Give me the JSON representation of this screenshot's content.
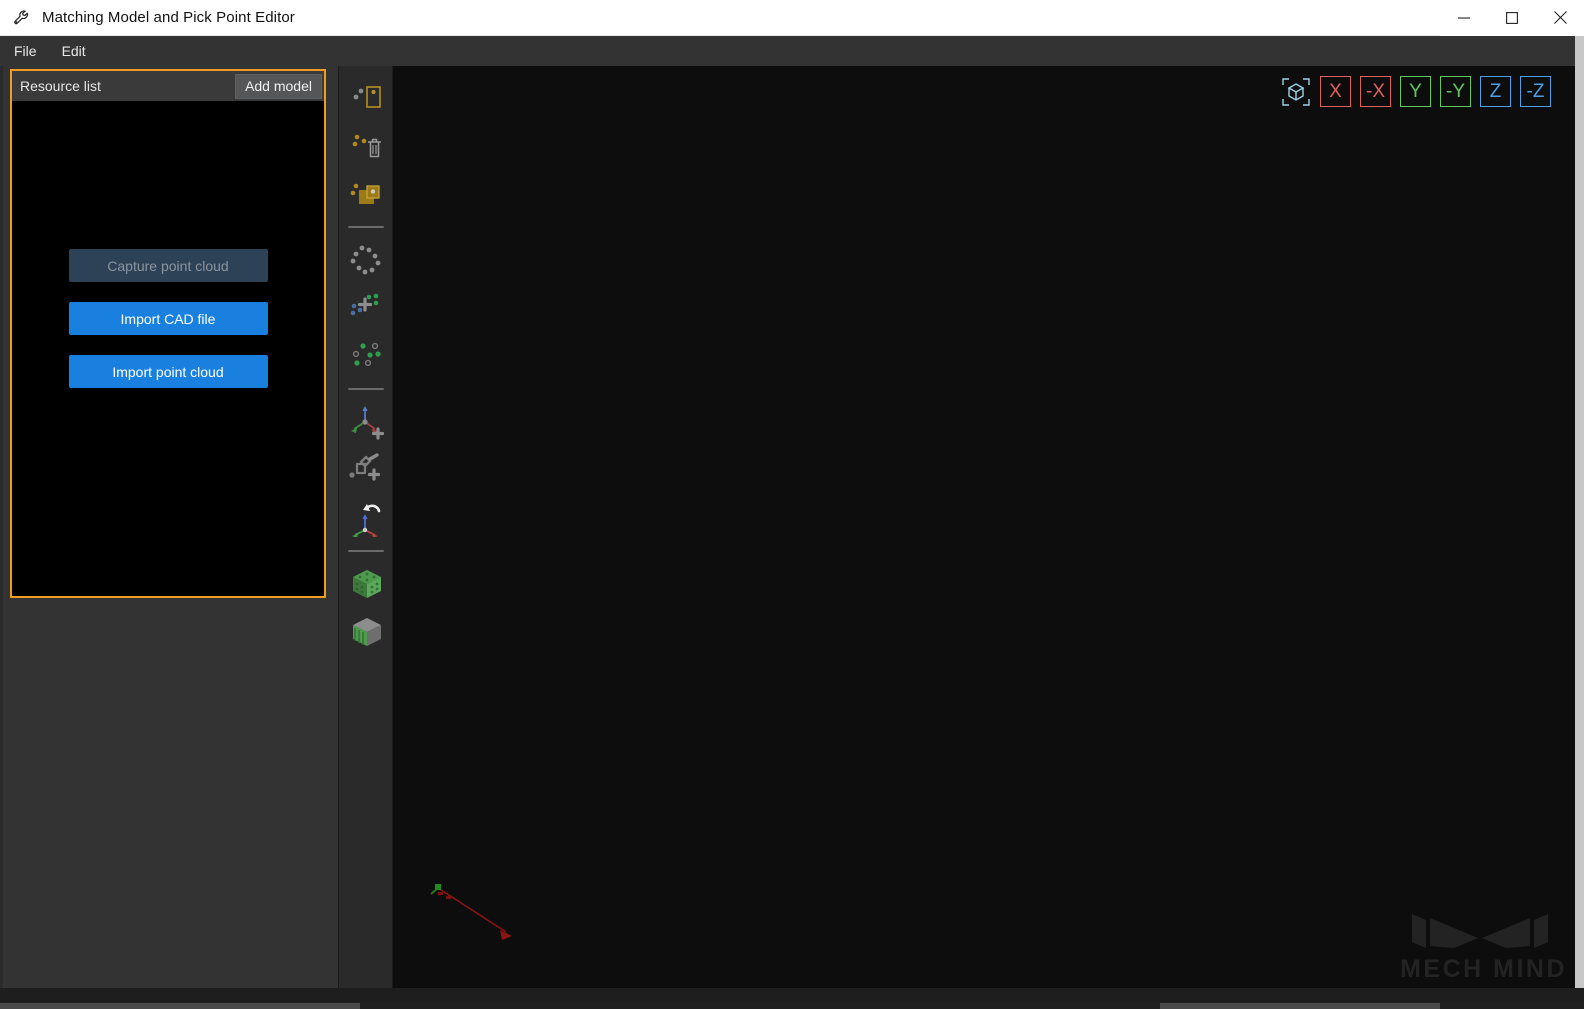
{
  "window": {
    "title": "Matching Model and Pick Point Editor",
    "app_icon": "wrench-icon",
    "controls": {
      "minimize": "minimize-icon",
      "maximize": "maximize-icon",
      "close": "close-icon"
    }
  },
  "menubar": {
    "items": [
      {
        "label": "File"
      },
      {
        "label": "Edit"
      }
    ]
  },
  "sidebar": {
    "panel": {
      "title": "Resource list",
      "add_model_label": "Add model",
      "border_color": "#ef9d20",
      "buttons": [
        {
          "label": "Capture point cloud",
          "state": "disabled",
          "color": "#2e4257"
        },
        {
          "label": "Import CAD file",
          "state": "enabled",
          "color": "#1a80e0"
        },
        {
          "label": "Import point cloud",
          "state": "enabled",
          "color": "#1a80e0"
        }
      ]
    }
  },
  "toolbar": {
    "items": [
      {
        "name": "select-region-icon",
        "tooltip": "Select region"
      },
      {
        "name": "delete-points-icon",
        "tooltip": "Delete selected points"
      },
      {
        "name": "crop-region-icon",
        "tooltip": "Crop region"
      },
      {
        "name": "separator-1",
        "tooltip": ""
      },
      {
        "name": "point-cloud-icon",
        "tooltip": "Point cloud"
      },
      {
        "name": "add-point-cloud-icon",
        "tooltip": "Add point cloud"
      },
      {
        "name": "select-points-icon",
        "tooltip": "Select points"
      },
      {
        "name": "separator-2",
        "tooltip": ""
      },
      {
        "name": "add-pick-point-icon",
        "tooltip": "Add pick point"
      },
      {
        "name": "add-symmetry-icon",
        "tooltip": "Add symmetry"
      },
      {
        "name": "rotate-frame-icon",
        "tooltip": "Rotate frame"
      },
      {
        "name": "separator-3",
        "tooltip": ""
      },
      {
        "name": "voxel-cube-icon",
        "tooltip": "Voxel model"
      },
      {
        "name": "solid-cube-icon",
        "tooltip": "Solid model"
      }
    ]
  },
  "viewport": {
    "background_color": "#0d0d0d",
    "view_buttons": [
      {
        "label": "",
        "name": "iso-view-button",
        "axis": "iso",
        "color": "#9fd4e8"
      },
      {
        "label": "X",
        "name": "x-view-button",
        "axis": "x",
        "color": "#e06060"
      },
      {
        "label": "-X",
        "name": "neg-x-view-button",
        "axis": "x",
        "color": "#e06060"
      },
      {
        "label": "Y",
        "name": "y-view-button",
        "axis": "y",
        "color": "#5ec95e"
      },
      {
        "label": "-Y",
        "name": "neg-y-view-button",
        "axis": "y",
        "color": "#5ec95e"
      },
      {
        "label": "Z",
        "name": "z-view-button",
        "axis": "z",
        "color": "#4d9fe8"
      },
      {
        "label": "-Z",
        "name": "neg-z-view-button",
        "axis": "z",
        "color": "#4d9fe8"
      }
    ],
    "axis_gizmo": {
      "x_color": "#c03030",
      "y_color": "#2f9e2f"
    },
    "watermark": {
      "text": "MECH MIND",
      "color": "#232323"
    }
  }
}
